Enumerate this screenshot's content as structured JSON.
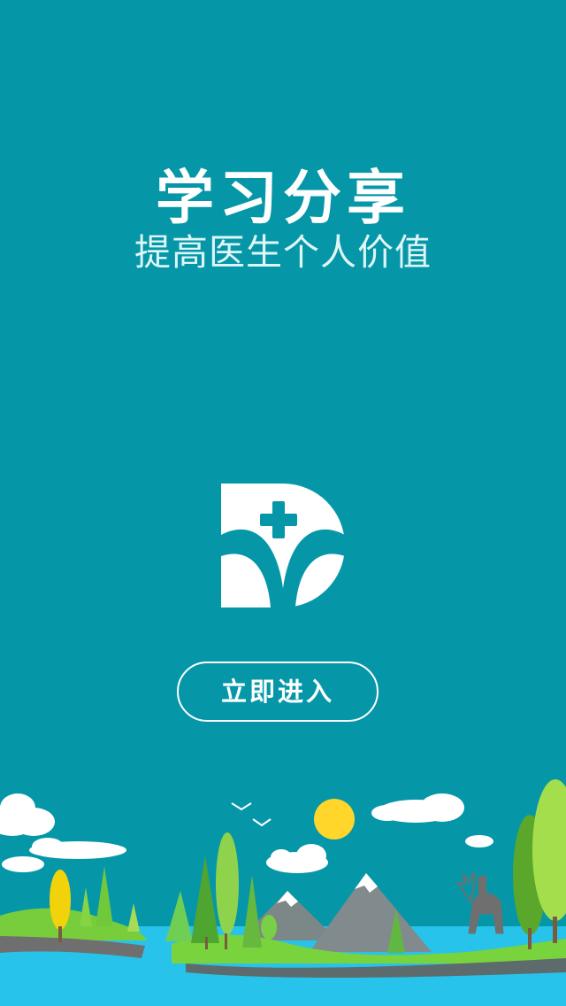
{
  "header": {
    "title": "学习分享",
    "subtitle": "提高医生个人价值"
  },
  "logo": {
    "icon": "medical-d-logo-icon"
  },
  "actions": {
    "enter_label": "立即进入"
  },
  "colors": {
    "background": "#0597a8",
    "text": "#ffffff",
    "water": "#27c3ea",
    "grass": "#78d13b"
  }
}
